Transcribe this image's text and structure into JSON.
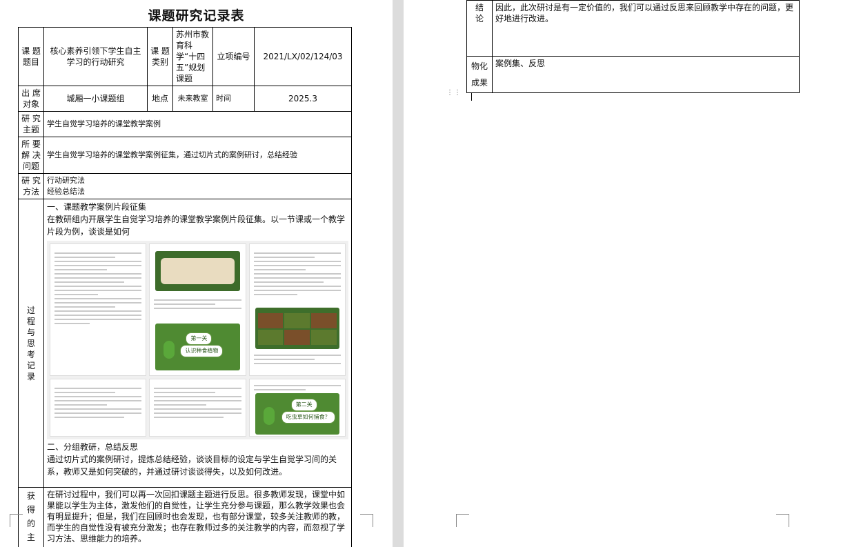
{
  "document": {
    "title": "课题研究记录表"
  },
  "header_row": {
    "topic_label": "课 题\n题目",
    "topic_value": "核心素养引领下学生自主学习的行动研究",
    "category_label": "课 题\n类别",
    "category_value": "苏州市教育科学“十四五”规划课题",
    "project_no_label": "立项编号",
    "project_no_value": "2021/LX/02/124/03"
  },
  "attendance_row": {
    "attendee_label": "出 席\n对象",
    "attendee_value": "城厢一小课题组",
    "location_label": "地点",
    "location_value": "未来教室",
    "time_label": "时间",
    "time_value": "2025.3"
  },
  "rows": {
    "theme_label": "研 究\n主题",
    "theme_value": "学生自觉学习培养的课堂教学案例",
    "problem_label": "所 要\n解 决\n问题",
    "problem_value": "学生自觉学习培养的课堂教学案例征集，通过切片式的案例研讨，总结经验",
    "method_label": "研 究\n方法",
    "method_line1": "行动研究法",
    "method_line2": "经验总结法",
    "process_label": "过\n程\n与\n思\n考\n记\n录",
    "process_heading1": "一、课题教学案例片段征集",
    "process_para1": "在教研组内开展学生自觉学习培养的课堂教学案例片段征集。以一节课或一个教学片段为例，谈谈是如何",
    "slide_caption_1": "第一关",
    "slide_subcaption_1": "认识种食植物",
    "slide_caption_2": "第二关",
    "slide_subcaption_2": "吃虫草如何捕食？",
    "process_heading2": "二、分组教研，总结反思",
    "process_para2": "通过切片式的案例研讨，提炼总结经验，谈谈目标的设定与学生自觉学习间的关系，教师又是如何突破的，并通过研讨谈谈得失，以及如何改进。",
    "gain_label": "获\n得\n的\n主\n要",
    "gain_value": "在研讨过程中，我们可以再一次回扣课题主题进行反思。很多教师发现，课堂中如果能以学生为主体，激发他们的自觉性，让学生充分参与课题，那么教学效果也会有明显提升；但是，我们在回顾时也会发现，也有部分课堂，较多关注教师的教，而学生的自觉性没有被充分激发；也存在教师过多的关注教学的内容，而忽视了学习方法、思维能力的培养。"
  },
  "right_page": {
    "conclusion_label": "结\n论",
    "conclusion_value": "因此，此次研讨是有一定价值的，我们可以通过反思来回顾教学中存在的问题，更好地进行改进。",
    "result_label": "物化\n成果",
    "result_value": "案例集、反思"
  }
}
